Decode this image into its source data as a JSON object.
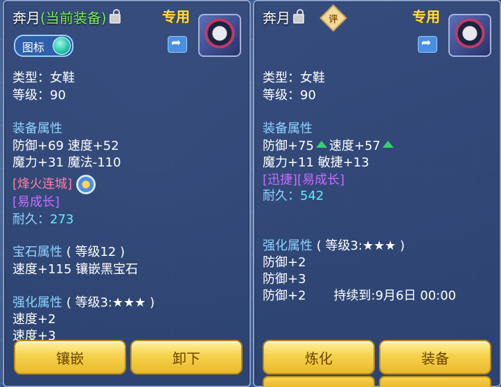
{
  "left": {
    "title_name": "奔月",
    "title_status": "(当前装备)",
    "special": "专用",
    "toggle_label": "图标",
    "type": "类型：女鞋",
    "level": "等级：90",
    "equip_attr_header": "装备属性",
    "attr_line1": "防御+69 速度+52",
    "attr_line2": "魔力+31 魔法-110",
    "special_effect": "[烽火连城]",
    "growth": "[易成长]",
    "durability_label": "耐久：",
    "durability_value": "273",
    "gem_header": "宝石属性",
    "gem_level": "( 等级12 )",
    "gem_line": "速度+115 镶嵌黑宝石",
    "enhance_header": "强化属性",
    "enhance_level": "( 等级3:★★★ )",
    "enhance_line1": "速度+2",
    "enhance_line2": "速度+3",
    "btn1": "镶嵌",
    "btn2": "卸下"
  },
  "right": {
    "title_name": "奔月",
    "badge": "评",
    "special": "专用",
    "type": "类型：女鞋",
    "level": "等级：90",
    "equip_attr_header": "装备属性",
    "attr1_a": "防御+75",
    "attr1_b": "速度+57",
    "attr_line2": "魔力+11 敏捷+13",
    "special_effect": "[迅捷][易成长]",
    "durability_label": "耐久：",
    "durability_value": "542",
    "enhance_header": "强化属性",
    "enhance_level": "( 等级3:★★★ )",
    "enhance_line1": "防御+2",
    "enhance_line2": "防御+3",
    "enhance_line3": "防御+2",
    "duration": "持续到:9月6日 00:00",
    "btn1": "炼化",
    "btn2": "装备"
  }
}
